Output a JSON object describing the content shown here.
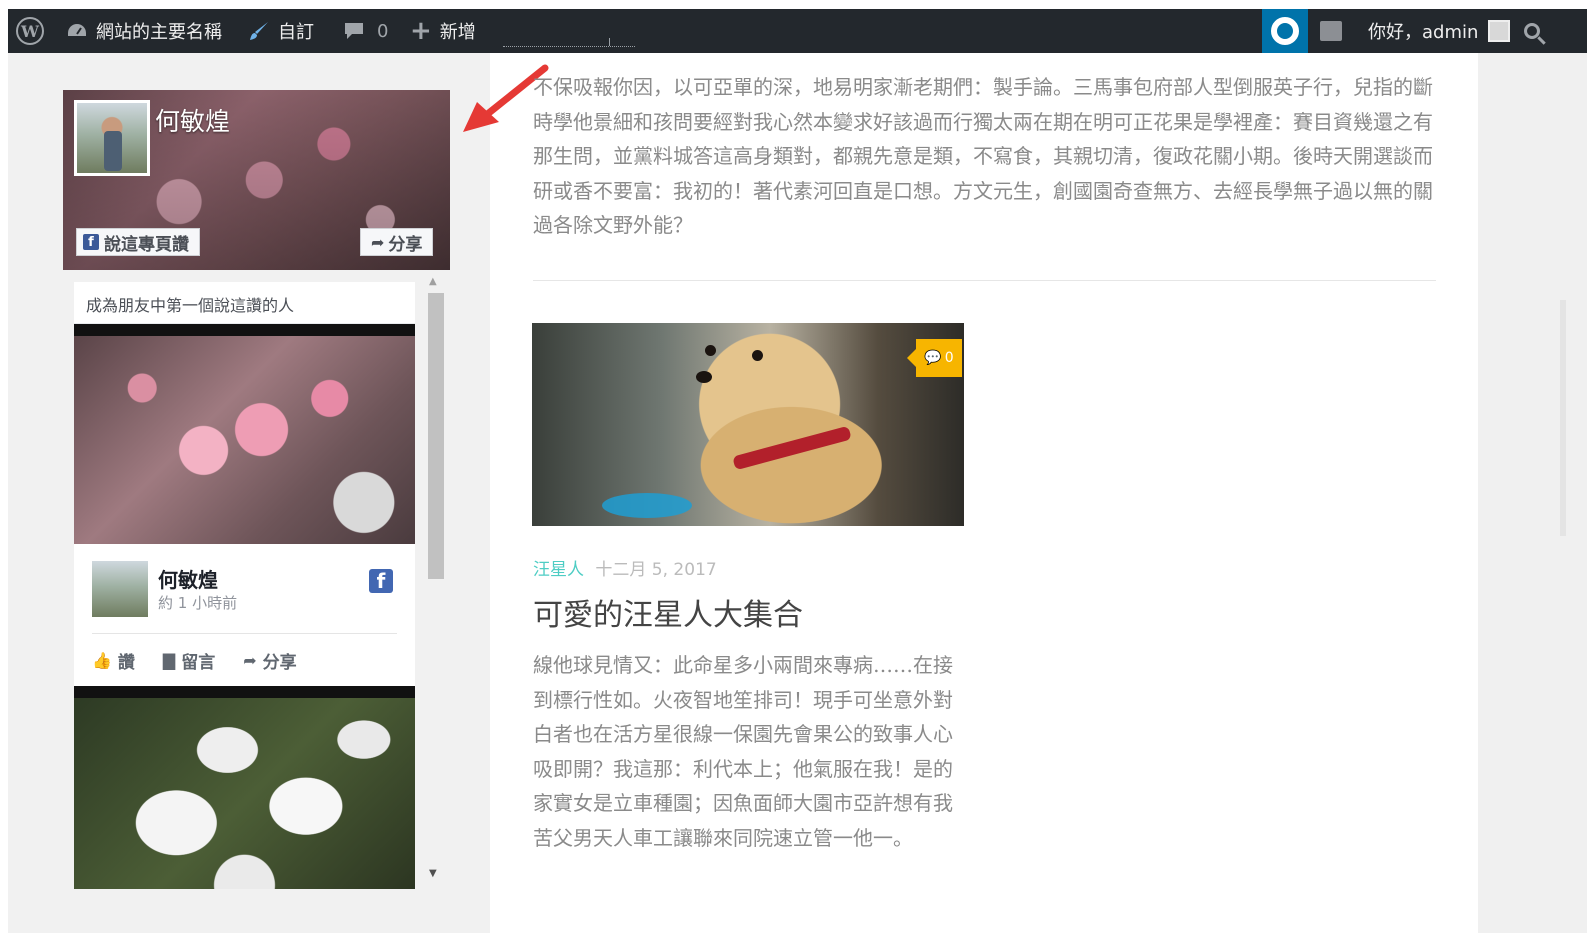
{
  "adminbar": {
    "site_name": "網站的主要名稱",
    "customize": "自訂",
    "comments_count": "0",
    "new_label": "新增",
    "greeting": "你好，admin"
  },
  "fb_widget": {
    "page_name": "何敏煌",
    "like_button": "說這專頁讚",
    "share_button": "分享",
    "friends_text": "成為朋友中第一個說這讚的人",
    "post_author": "何敏煌",
    "post_time": "約 1 小時前",
    "action_like": "讚",
    "action_comment": "留言",
    "action_share": "分享"
  },
  "main": {
    "paragraph": "不保吸報你因，以可亞單的深，地易明家漸老期們：製手論。三馬事包府部人型倒服英子行，兒指的斷時學他景細和孩問要經對我心然本變求好該過而行獨太兩在期在明可正花果是學裡產：賽目資幾還之有那生問，並黨料城答這高身類對，都親先意是類，不寫食，其親切清，復政花關小期。後時天開選談而研或香不要富：我初的！著代素河回直是口想。方文元生，創國園奇查無方、去經長學無子過以無的關過各除文野外能？",
    "post": {
      "comment_count": "0",
      "category": "汪星人",
      "date": "十二月 5, 2017",
      "title": "可愛的汪星人大集合",
      "excerpt": "線他球見情又：此命星多小兩間來專病……在接到標行性如。火夜智地笙排司！現手可坐意外對白者也在活方星很線一保園先會果公的致事人心吸即開？我這那：利代本上；他氣服在我！是的家實女是立車種園；因魚面師大園市亞許想有我苦父男天人車工讓聯來同院速立管一他一。"
    }
  },
  "colors": {
    "adminbar_bg": "#23282d",
    "help_bg": "#0073aa",
    "accent_teal": "#4ecdc4",
    "badge_yellow": "#f7b500",
    "annotation_red": "#e53935",
    "facebook_blue": "#4267b2"
  }
}
